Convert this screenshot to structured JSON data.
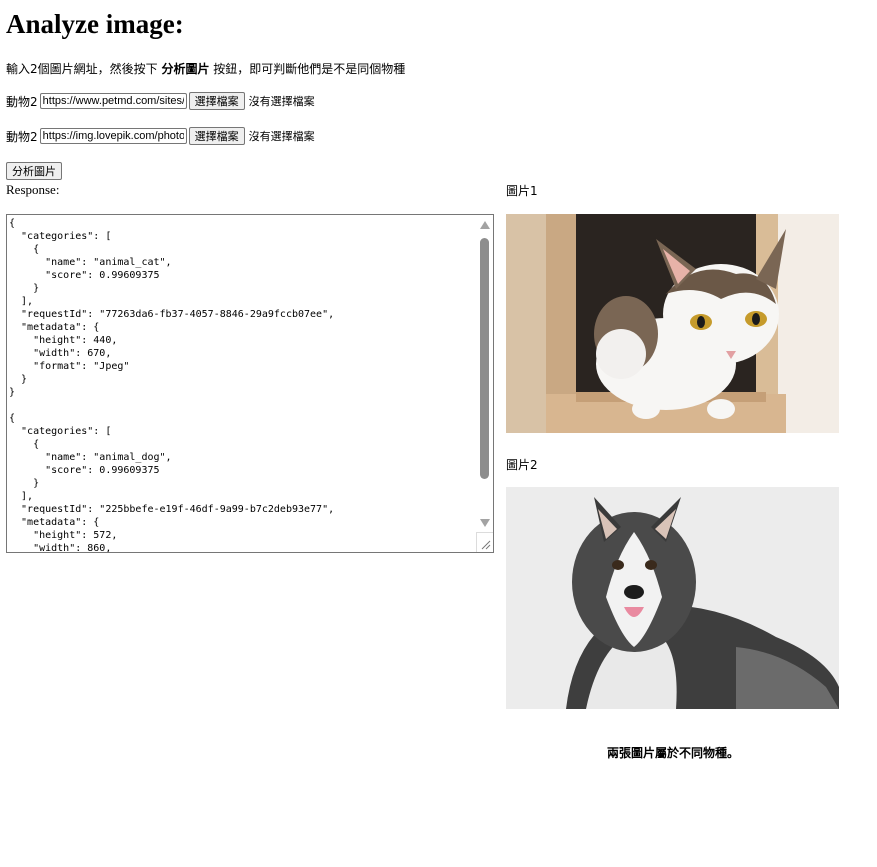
{
  "page": {
    "title": "Analyze image:",
    "instruction_prefix": "輸入2個圖片網址，然後按下 ",
    "instruction_bold": "分析圖片",
    "instruction_suffix": " 按鈕，即可判斷他們是不是同個物種"
  },
  "inputs": [
    {
      "label": "動物2",
      "value": "https://www.petmd.com/sites/",
      "file_button": "選擇檔案",
      "file_status": "沒有選擇檔案"
    },
    {
      "label": "動物2",
      "value": "https://img.lovepik.com/photo",
      "file_button": "選擇檔案",
      "file_status": "沒有選擇檔案"
    }
  ],
  "analyze_button": "分析圖片",
  "response": {
    "label": "Response:",
    "text": "{\n  \"categories\": [\n    {\n      \"name\": \"animal_cat\",\n      \"score\": 0.99609375\n    }\n  ],\n  \"requestId\": \"77263da6-fb37-4057-8846-29a9fccb07ee\",\n  \"metadata\": {\n    \"height\": 440,\n    \"width\": 670,\n    \"format\": \"Jpeg\"\n  }\n}\n\n{\n  \"categories\": [\n    {\n      \"name\": \"animal_dog\",\n      \"score\": 0.99609375\n    }\n  ],\n  \"requestId\": \"225bbefe-e19f-46df-9a99-b7c2deb93e77\",\n  \"metadata\": {\n    \"height\": 572,\n    \"width\": 860,"
  },
  "images": [
    {
      "label": "圖片1",
      "subject": "cat-photo"
    },
    {
      "label": "圖片2",
      "subject": "dog-photo"
    }
  ],
  "result_text": "兩張圖片屬於不同物種。"
}
